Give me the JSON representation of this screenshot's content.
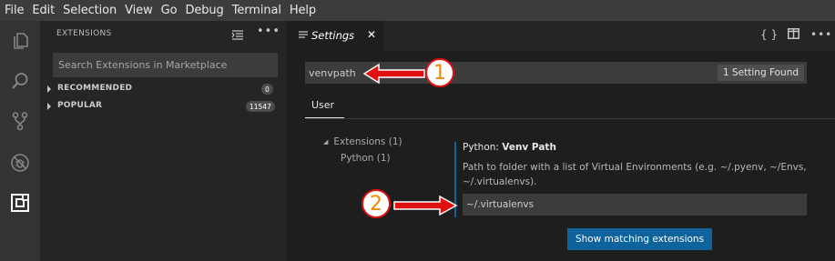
{
  "menubar": {
    "items": [
      "File",
      "Edit",
      "Selection",
      "View",
      "Go",
      "Debug",
      "Terminal",
      "Help"
    ]
  },
  "activitybar": {
    "icons": [
      "files-icon",
      "search-icon",
      "source-control-icon",
      "debug-icon",
      "extensions-icon"
    ]
  },
  "sidebar": {
    "title": "EXTENSIONS",
    "search_placeholder": "Search Extensions in Marketplace",
    "sections": [
      {
        "label": "RECOMMENDED",
        "count": "0"
      },
      {
        "label": "POPULAR",
        "count": "11547"
      }
    ]
  },
  "editor": {
    "tab": {
      "label": "Settings",
      "close": "✕"
    },
    "actions": [
      "{ }",
      "split-editor-icon",
      "more-icon"
    ],
    "search_value": "venvpath",
    "found_label": "1 Setting Found",
    "scope_tab": "User",
    "toc": [
      {
        "label": "Extensions (1)"
      },
      {
        "label": "Python (1)"
      }
    ],
    "setting": {
      "category": "Python: ",
      "name": "Venv Path",
      "description": "Path to folder with a list of Virtual Environments (e.g. ~/.pyenv, ~/Envs, ~/.virtualenvs).",
      "value": "~/.virtualenvs"
    },
    "button_label": "Show matching extensions"
  },
  "annotations": {
    "marker1": "1",
    "marker2": "2",
    "arrow_color": "#e01010",
    "number_color": "#f08a00"
  },
  "colors": {
    "accent": "#0e639c",
    "sidebar_bg": "#252526",
    "editor_bg": "#1e1e1e"
  }
}
